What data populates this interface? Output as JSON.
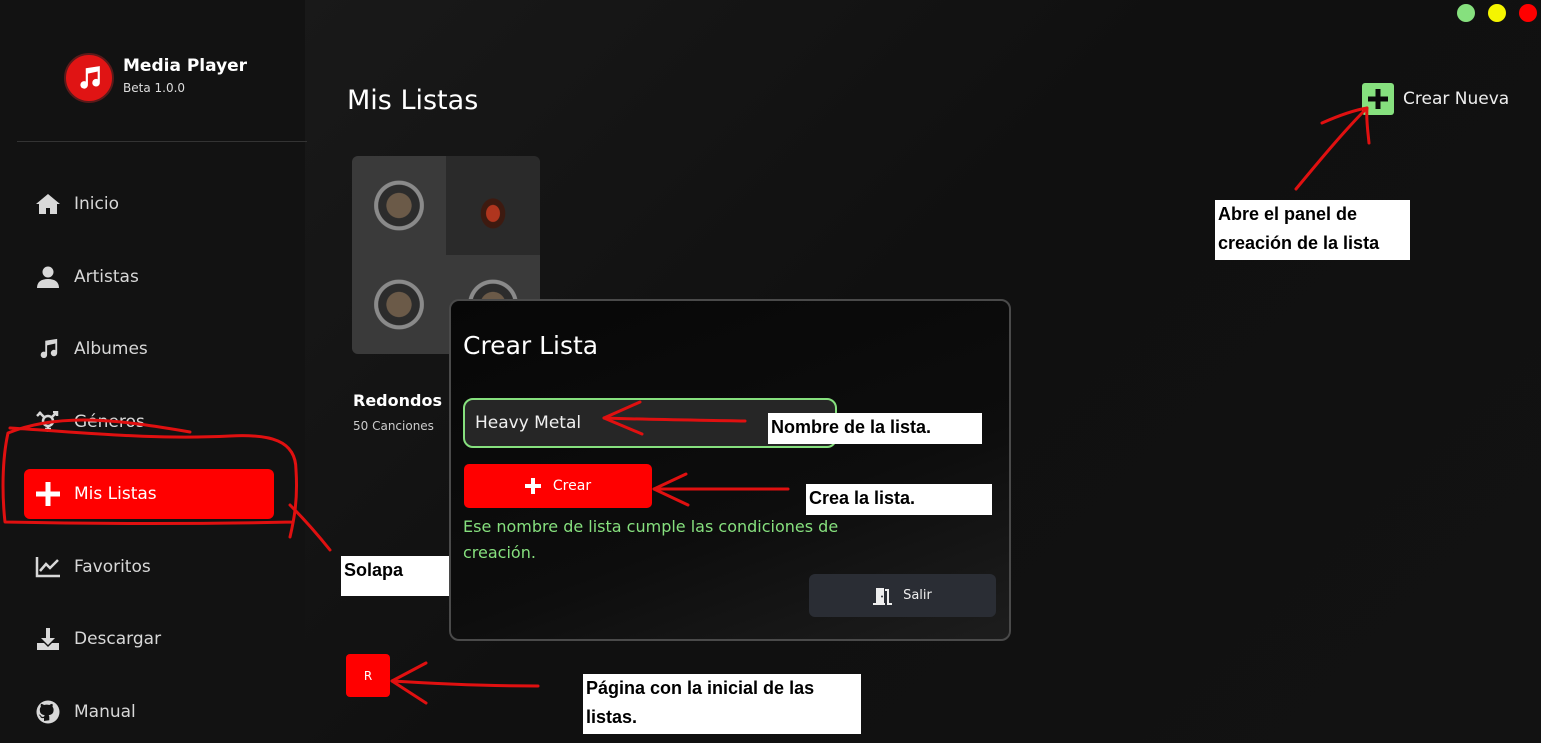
{
  "app": {
    "title": "Media Player",
    "version": "Beta 1.0.0",
    "brand_color": "#ff0000"
  },
  "sidebar": {
    "items": [
      {
        "label": "Inicio",
        "icon": "home-icon"
      },
      {
        "label": "Artistas",
        "icon": "user-icon"
      },
      {
        "label": "Albumes",
        "icon": "music-note-icon"
      },
      {
        "label": "Géneros",
        "icon": "gender-icon"
      },
      {
        "label": "Mis Listas",
        "icon": "plus-icon",
        "active": true
      },
      {
        "label": "Favoritos",
        "icon": "chart-line-icon"
      },
      {
        "label": "Descargar",
        "icon": "download-icon"
      },
      {
        "label": "Manual",
        "icon": "github-icon"
      }
    ]
  },
  "main": {
    "title": "Mis Listas",
    "new_button_label": "Crear Nueva",
    "playlists": [
      {
        "name": "Redondos",
        "count": "50 Canciones"
      }
    ],
    "pagination": [
      "R"
    ]
  },
  "modal": {
    "title": "Crear Lista",
    "input_value": "Heavy Metal",
    "create_label": "Crear",
    "status": "Ese nombre de lista cumple las condiciones de creación.",
    "exit_label": "Salir"
  },
  "annotations": {
    "new_panel": "Abre el panel de creación de la lista",
    "name": "Nombre de la lista.",
    "create": "Crea la lista.",
    "tab": "Solapa",
    "page": "Página con la inicial de las listas."
  },
  "window_controls": [
    "#86e07e",
    "#f5f500",
    "#ff0000"
  ],
  "colors": {
    "accent_green": "#86e07e",
    "annotation_red": "#e01010"
  }
}
